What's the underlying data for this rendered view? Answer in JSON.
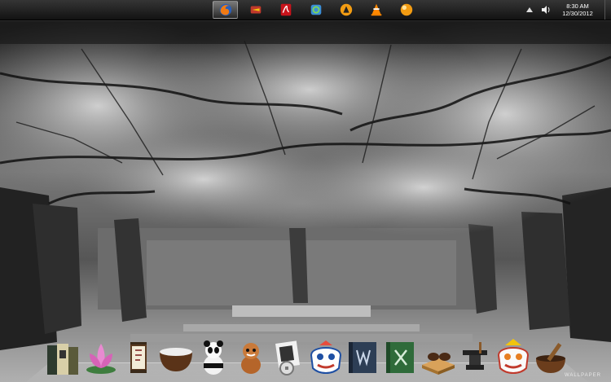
{
  "taskbar": {
    "apps": [
      {
        "name": "firefox-icon",
        "active": true
      },
      {
        "name": "network-icon",
        "active": false
      },
      {
        "name": "adobe-reader-icon",
        "active": false
      },
      {
        "name": "sync-icon",
        "active": false
      },
      {
        "name": "aimp-icon",
        "active": false
      },
      {
        "name": "vlc-icon",
        "active": false
      },
      {
        "name": "orange-orb-icon",
        "active": false
      }
    ],
    "tray": {
      "time": "8:30 AM",
      "date": "12/30/2012"
    }
  },
  "dock": {
    "items": [
      {
        "name": "books-icon"
      },
      {
        "name": "lotus-icon"
      },
      {
        "name": "lantern-icon"
      },
      {
        "name": "rice-bowl-icon"
      },
      {
        "name": "panda-icon"
      },
      {
        "name": "red-panda-icon"
      },
      {
        "name": "coin-note-icon"
      },
      {
        "name": "lion-mask-icon"
      },
      {
        "name": "word-book-icon"
      },
      {
        "name": "excel-book-icon"
      },
      {
        "name": "go-board-icon"
      },
      {
        "name": "anvil-icon"
      },
      {
        "name": "lion-dance-icon"
      },
      {
        "name": "mortar-icon"
      }
    ],
    "watermark": "WALLPAPER"
  }
}
